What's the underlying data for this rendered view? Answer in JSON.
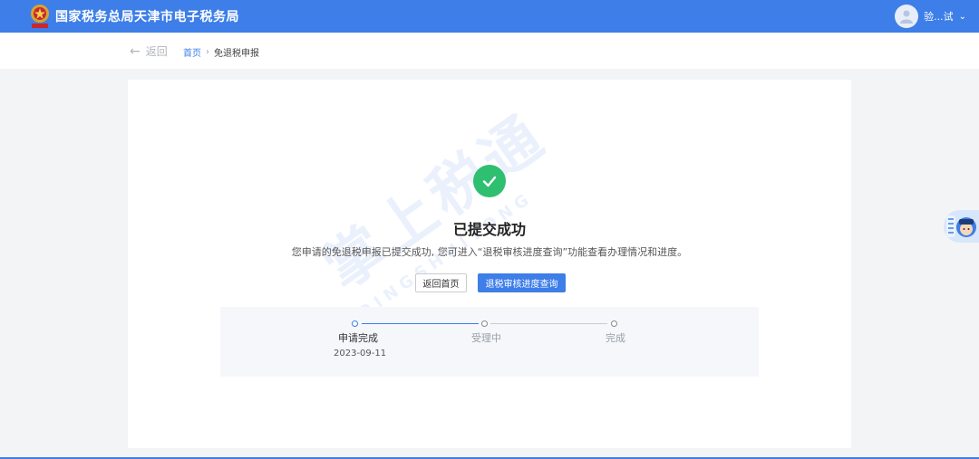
{
  "header": {
    "title": "国家税务总局天津市电子税务局",
    "user_name": "验...试",
    "colors": {
      "brand": "#3d7ee8"
    }
  },
  "nav": {
    "back_label": "返回",
    "breadcrumb": {
      "home": "首页",
      "current": "免退税申报"
    }
  },
  "result": {
    "title": "已提交成功",
    "description": "您申请的免退税申报已提交成功, 您可进入“退税审核进度查询”功能查看办理情况和进度。",
    "buttons": {
      "home": "返回首页",
      "query": "退税审核进度查询"
    },
    "success_color": "#2fbf71"
  },
  "watermark": {
    "main": "掌上税通",
    "sub": "QINGSHUITONG"
  },
  "progress": {
    "steps": [
      {
        "label": "申请完成",
        "date": "2023-09-11",
        "state": "done"
      },
      {
        "label": "受理中",
        "date": "",
        "state": "pending"
      },
      {
        "label": "完成",
        "date": "",
        "state": "pending"
      }
    ]
  },
  "helper": {
    "icon": "assistant-icon"
  }
}
